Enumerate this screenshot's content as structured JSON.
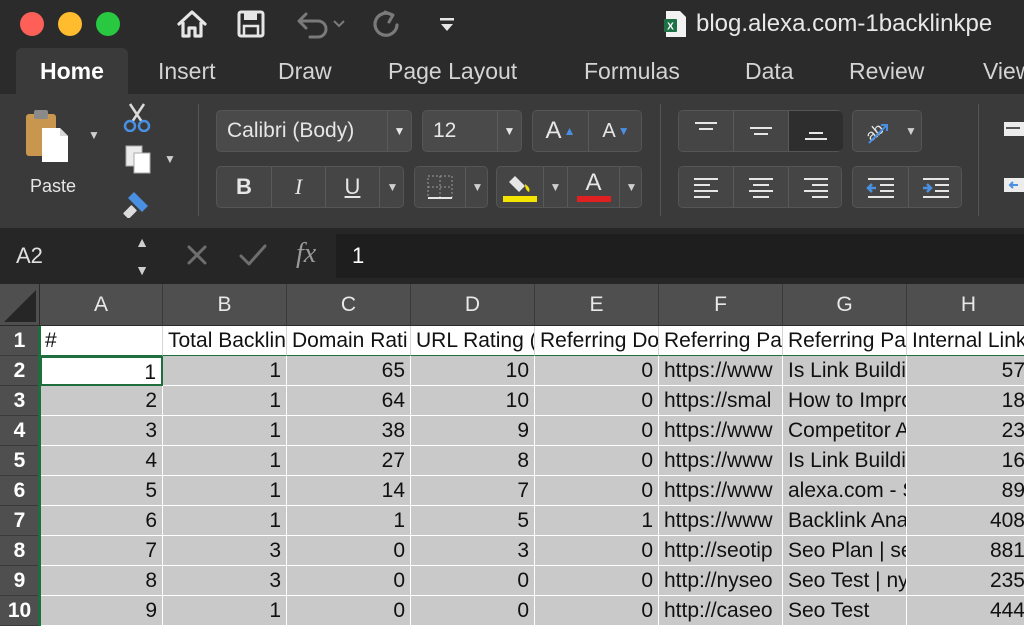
{
  "window": {
    "document_title": "blog.alexa.com-1backlinkpe",
    "file_icon": "excel-file-icon"
  },
  "toolbar": {
    "icons": [
      "home-icon",
      "save-icon",
      "undo-icon",
      "redo-icon",
      "customize-dropdown-icon"
    ]
  },
  "tabs": [
    {
      "label": "Home",
      "active": true
    },
    {
      "label": "Insert"
    },
    {
      "label": "Draw"
    },
    {
      "label": "Page Layout"
    },
    {
      "label": "Formulas"
    },
    {
      "label": "Data"
    },
    {
      "label": "Review"
    },
    {
      "label": "View"
    }
  ],
  "ribbon": {
    "paste_label": "Paste",
    "font_name": "Calibri (Body)",
    "font_size": "12",
    "grow_font": "A",
    "shrink_font": "A",
    "bold": "B",
    "italic": "I",
    "underline": "U",
    "font_color_glyph": "A",
    "highlight_color": "#f3e500",
    "font_color": "#e02020"
  },
  "formula_bar": {
    "name_box": "A2",
    "fx_label": "fx",
    "value": "1"
  },
  "colors": {
    "accent": "#1e6e3e",
    "cell_fill": "#c9c9c9"
  },
  "sheet": {
    "columns": [
      "A",
      "B",
      "C",
      "D",
      "E",
      "F",
      "G",
      "H"
    ],
    "row_numbers": [
      "1",
      "2",
      "3",
      "4",
      "5",
      "6",
      "7",
      "8",
      "9",
      "10"
    ],
    "header_row": [
      "#",
      "Total Backlin",
      "Domain Rati",
      "URL Rating (",
      "Referring Do",
      "Referring Pa",
      "Referring Pa",
      "Internal Link"
    ],
    "rows": [
      [
        "1",
        "1",
        "65",
        "10",
        "0",
        "https://www",
        "Is Link Buildi",
        "57"
      ],
      [
        "2",
        "1",
        "64",
        "10",
        "0",
        "https://smal",
        "How to Impro",
        "18"
      ],
      [
        "3",
        "1",
        "38",
        "9",
        "0",
        "https://www",
        "Competitor A",
        "23"
      ],
      [
        "4",
        "1",
        "27",
        "8",
        "0",
        "https://www",
        "Is Link Buildi",
        "16"
      ],
      [
        "5",
        "1",
        "14",
        "7",
        "0",
        "https://www",
        "alexa.com - S",
        "89"
      ],
      [
        "6",
        "1",
        "1",
        "5",
        "1",
        "https://www",
        "Backlink Ana",
        "408"
      ],
      [
        "7",
        "3",
        "0",
        "3",
        "0",
        "http://seotip",
        "Seo Plan | se",
        "881"
      ],
      [
        "8",
        "3",
        "0",
        "0",
        "0",
        "http://nyseo",
        "Seo Test | ny",
        "235"
      ],
      [
        "9",
        "1",
        "0",
        "0",
        "0",
        "http://caseo",
        "Seo Test",
        "444"
      ]
    ]
  }
}
